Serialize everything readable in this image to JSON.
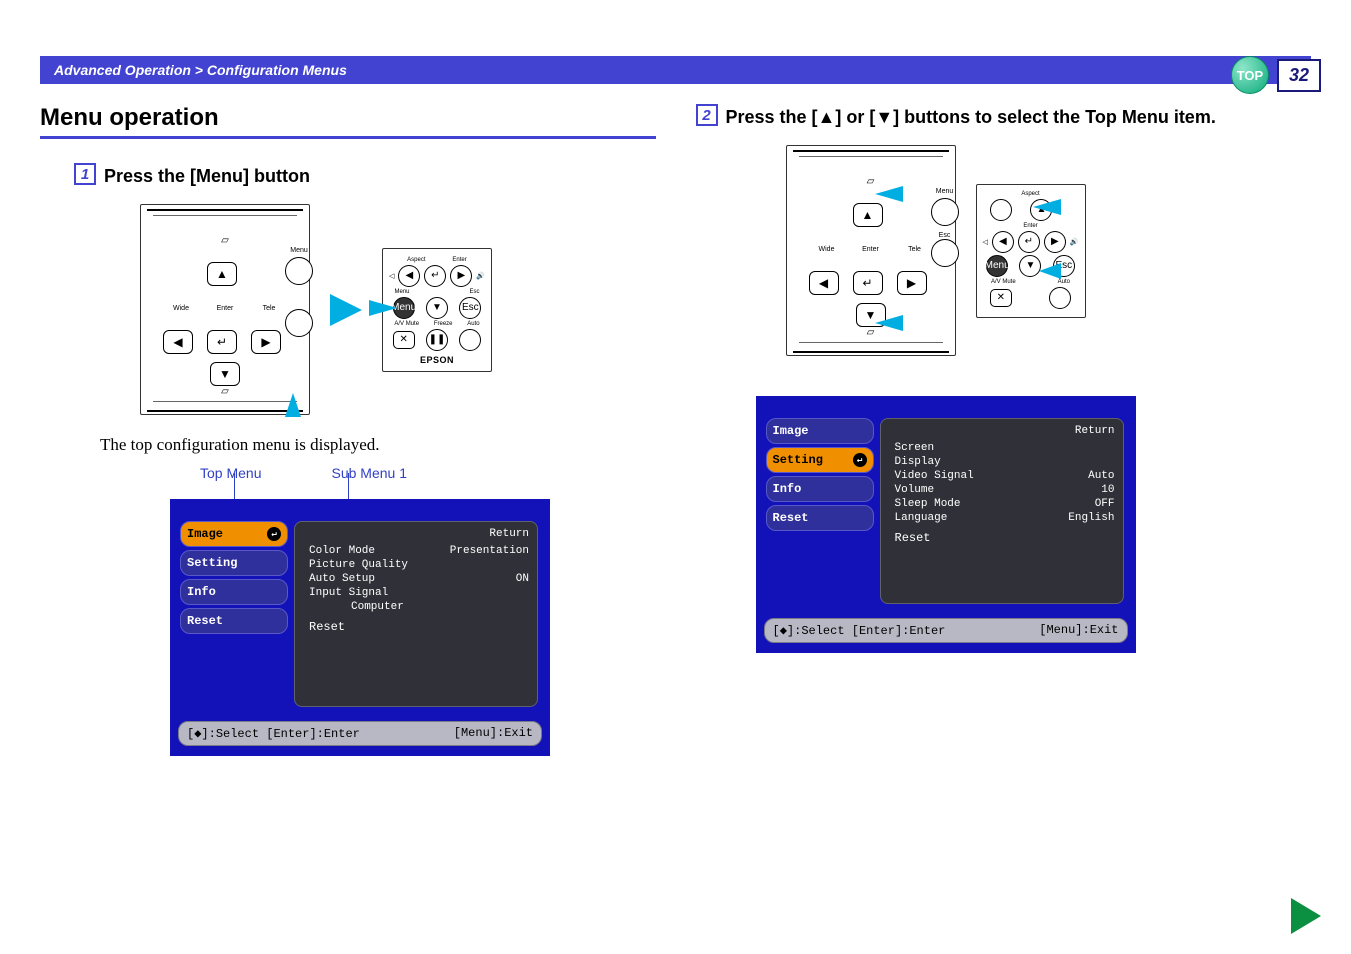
{
  "breadcrumb": "Advanced Operation > Configuration Menus",
  "page_number": "32",
  "top_badge": "TOP",
  "section_title": "Menu operation",
  "steps": {
    "s1": {
      "num": "1",
      "text": "Press the [Menu] button"
    },
    "s2": {
      "num": "2",
      "text": "Press the [▲] or [▼] buttons to select the Top Menu item."
    }
  },
  "remote": {
    "wide": "Wide",
    "enter": "Enter",
    "tele": "Tele",
    "menu": "Menu",
    "esc": "Esc",
    "aspect": "Aspect",
    "avmute": "A/V Mute",
    "freeze": "Freeze",
    "auto": "Auto",
    "epson": "EPSON"
  },
  "caption1": "The top configuration menu is displayed.",
  "labels": {
    "topmenu": "Top Menu",
    "submenu": "Sub Menu 1"
  },
  "osd1": {
    "side": [
      "Image",
      "Setting",
      "Info",
      "Reset"
    ],
    "selected_index": 0,
    "return": "Return",
    "rows": [
      {
        "k": "Color Mode",
        "v": "Presentation"
      },
      {
        "k": "Picture Quality",
        "v": ""
      },
      {
        "k": "Auto Setup",
        "v": "ON"
      },
      {
        "k": "Input Signal",
        "v": ""
      },
      {
        "k_indent": "Computer",
        "v": ""
      }
    ],
    "reset": "Reset",
    "bar_left": "[◆]:Select [Enter]:Enter",
    "bar_right": "[Menu]:Exit"
  },
  "osd2": {
    "side": [
      "Image",
      "Setting",
      "Info",
      "Reset"
    ],
    "selected_index": 1,
    "return": "Return",
    "rows": [
      {
        "k": "Screen",
        "v": ""
      },
      {
        "k": "Display",
        "v": ""
      },
      {
        "k": "Video Signal",
        "v": "Auto"
      },
      {
        "k": "Volume",
        "v": "10"
      },
      {
        "k": "Sleep Mode",
        "v": "OFF"
      },
      {
        "k": "Language",
        "v": "English"
      }
    ],
    "reset": "Reset",
    "bar_left": "[◆]:Select [Enter]:Enter",
    "bar_right": "[Menu]:Exit"
  }
}
